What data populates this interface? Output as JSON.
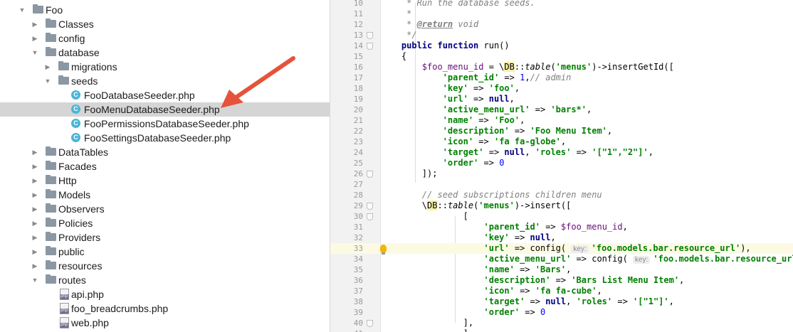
{
  "tree": {
    "items": [
      {
        "label": "Foo",
        "depth": 0,
        "kind": "folder",
        "expanded": true
      },
      {
        "label": "Classes",
        "depth": 1,
        "kind": "folder",
        "expanded": false
      },
      {
        "label": "config",
        "depth": 1,
        "kind": "folder",
        "expanded": false
      },
      {
        "label": "database",
        "depth": 1,
        "kind": "folder",
        "expanded": true
      },
      {
        "label": "migrations",
        "depth": 2,
        "kind": "folder",
        "expanded": false
      },
      {
        "label": "seeds",
        "depth": 2,
        "kind": "folder",
        "expanded": true
      },
      {
        "label": "FooDatabaseSeeder.php",
        "depth": 3,
        "kind": "class"
      },
      {
        "label": "FooMenuDatabaseSeeder.php",
        "depth": 3,
        "kind": "class",
        "selected": true
      },
      {
        "label": "FooPermissionsDatabaseSeeder.php",
        "depth": 3,
        "kind": "class"
      },
      {
        "label": "FooSettingsDatabaseSeeder.php",
        "depth": 3,
        "kind": "class"
      },
      {
        "label": "DataTables",
        "depth": 1,
        "kind": "folder",
        "expanded": false
      },
      {
        "label": "Facades",
        "depth": 1,
        "kind": "folder",
        "expanded": false
      },
      {
        "label": "Http",
        "depth": 1,
        "kind": "folder",
        "expanded": false
      },
      {
        "label": "Models",
        "depth": 1,
        "kind": "folder",
        "expanded": false
      },
      {
        "label": "Observers",
        "depth": 1,
        "kind": "folder",
        "expanded": false
      },
      {
        "label": "Policies",
        "depth": 1,
        "kind": "folder",
        "expanded": false
      },
      {
        "label": "Providers",
        "depth": 1,
        "kind": "folder",
        "expanded": false
      },
      {
        "label": "public",
        "depth": 1,
        "kind": "folder",
        "expanded": false
      },
      {
        "label": "resources",
        "depth": 1,
        "kind": "folder",
        "expanded": false
      },
      {
        "label": "routes",
        "depth": 1,
        "kind": "folder",
        "expanded": true
      },
      {
        "label": "api.php",
        "depth": 2,
        "kind": "php"
      },
      {
        "label": "foo_breadcrumbs.php",
        "depth": 2,
        "kind": "php"
      },
      {
        "label": "web.php",
        "depth": 2,
        "kind": "php"
      }
    ]
  },
  "editor": {
    "current_line": 33,
    "lines": [
      {
        "n": "10",
        "fold": false,
        "tokens": [
          [
            "cmt",
            "     * Run the database seeds."
          ]
        ]
      },
      {
        "n": "11",
        "fold": false,
        "tokens": [
          [
            "cmt",
            "     *"
          ]
        ]
      },
      {
        "n": "12",
        "fold": false,
        "tokens": [
          [
            "cmt",
            "     * "
          ],
          [
            "doctag",
            "@return"
          ],
          [
            "cmt",
            " void"
          ]
        ]
      },
      {
        "n": "13",
        "fold": true,
        "tokens": [
          [
            "cmt",
            "     */"
          ]
        ]
      },
      {
        "n": "14",
        "fold": true,
        "tokens": [
          [
            "",
            "    "
          ],
          [
            "kw",
            "public function "
          ],
          [
            "",
            "run()"
          ]
        ]
      },
      {
        "n": "15",
        "fold": false,
        "tokens": [
          [
            "",
            "    {"
          ]
        ]
      },
      {
        "n": "16",
        "fold": false,
        "tokens": [
          [
            "",
            "        "
          ],
          [
            "var",
            "$foo_menu_id"
          ],
          [
            "",
            " = \\"
          ],
          [
            "cls",
            "DB"
          ],
          [
            "",
            "::"
          ],
          [
            "mth",
            "table"
          ],
          [
            "",
            "("
          ],
          [
            "str",
            "'menus'"
          ],
          [
            "",
            ")->insertGetId(["
          ]
        ]
      },
      {
        "n": "17",
        "fold": false,
        "tokens": [
          [
            "",
            "            "
          ],
          [
            "str",
            "'parent_id'"
          ],
          [
            "",
            " => "
          ],
          [
            "num",
            "1"
          ],
          [
            "",
            ","
          ],
          [
            "cmt",
            "// admin"
          ]
        ]
      },
      {
        "n": "18",
        "fold": false,
        "tokens": [
          [
            "",
            "            "
          ],
          [
            "str",
            "'key'"
          ],
          [
            "",
            " => "
          ],
          [
            "str",
            "'foo'"
          ],
          [
            "",
            ","
          ]
        ]
      },
      {
        "n": "19",
        "fold": false,
        "tokens": [
          [
            "",
            "            "
          ],
          [
            "str",
            "'url'"
          ],
          [
            "",
            " => "
          ],
          [
            "kw",
            "null"
          ],
          [
            "",
            ","
          ]
        ]
      },
      {
        "n": "20",
        "fold": false,
        "tokens": [
          [
            "",
            "            "
          ],
          [
            "str",
            "'active_menu_url'"
          ],
          [
            "",
            " => "
          ],
          [
            "str",
            "'bars*'"
          ],
          [
            "",
            ","
          ]
        ]
      },
      {
        "n": "21",
        "fold": false,
        "tokens": [
          [
            "",
            "            "
          ],
          [
            "str",
            "'name'"
          ],
          [
            "",
            " => "
          ],
          [
            "str",
            "'Foo'"
          ],
          [
            "",
            ","
          ]
        ]
      },
      {
        "n": "22",
        "fold": false,
        "tokens": [
          [
            "",
            "            "
          ],
          [
            "str",
            "'description'"
          ],
          [
            "",
            " => "
          ],
          [
            "str",
            "'Foo Menu Item'"
          ],
          [
            "",
            ","
          ]
        ]
      },
      {
        "n": "23",
        "fold": false,
        "tokens": [
          [
            "",
            "            "
          ],
          [
            "str",
            "'icon'"
          ],
          [
            "",
            " => "
          ],
          [
            "str",
            "'fa fa-globe'"
          ],
          [
            "",
            ","
          ]
        ]
      },
      {
        "n": "24",
        "fold": false,
        "tokens": [
          [
            "",
            "            "
          ],
          [
            "str",
            "'target'"
          ],
          [
            "",
            " => "
          ],
          [
            "kw",
            "null"
          ],
          [
            "",
            ", "
          ],
          [
            "str",
            "'roles'"
          ],
          [
            "",
            " => "
          ],
          [
            "str",
            "'[\"1\",\"2\"]'"
          ],
          [
            "",
            ","
          ]
        ]
      },
      {
        "n": "25",
        "fold": false,
        "tokens": [
          [
            "",
            "            "
          ],
          [
            "str",
            "'order'"
          ],
          [
            "",
            " => "
          ],
          [
            "num",
            "0"
          ]
        ]
      },
      {
        "n": "26",
        "fold": true,
        "tokens": [
          [
            "",
            "        ]);"
          ]
        ]
      },
      {
        "n": "27",
        "fold": false,
        "tokens": [
          [
            "",
            ""
          ]
        ]
      },
      {
        "n": "28",
        "fold": false,
        "tokens": [
          [
            "",
            "        "
          ],
          [
            "cmt",
            "// seed subscriptions children menu"
          ]
        ]
      },
      {
        "n": "29",
        "fold": true,
        "tokens": [
          [
            "",
            "        \\"
          ],
          [
            "cls",
            "DB"
          ],
          [
            "",
            "::"
          ],
          [
            "mth",
            "table"
          ],
          [
            "",
            "("
          ],
          [
            "str",
            "'menus'"
          ],
          [
            "",
            ")->insert(["
          ]
        ]
      },
      {
        "n": "30",
        "fold": true,
        "tokens": [
          [
            "",
            "                ["
          ]
        ]
      },
      {
        "n": "31",
        "fold": false,
        "tokens": [
          [
            "",
            "                    "
          ],
          [
            "str",
            "'parent_id'"
          ],
          [
            "",
            " => "
          ],
          [
            "var",
            "$foo_menu_id"
          ],
          [
            "",
            ","
          ]
        ]
      },
      {
        "n": "32",
        "fold": false,
        "tokens": [
          [
            "",
            "                    "
          ],
          [
            "str",
            "'key'"
          ],
          [
            "",
            " => "
          ],
          [
            "kw",
            "null"
          ],
          [
            "",
            ","
          ]
        ]
      },
      {
        "n": "33",
        "fold": false,
        "tokens": [
          [
            "",
            "                    "
          ],
          [
            "str",
            "'url'"
          ],
          [
            "",
            " => config( "
          ],
          [
            "hint",
            "key:"
          ],
          [
            "str",
            "'foo.models.bar.resource_url'"
          ],
          [
            "",
            "),"
          ]
        ]
      },
      {
        "n": "34",
        "fold": false,
        "tokens": [
          [
            "",
            "                    "
          ],
          [
            "str",
            "'active_menu_url'"
          ],
          [
            "",
            " => config( "
          ],
          [
            "hint",
            "key:"
          ],
          [
            "str",
            "'foo.models.bar.resource_url'"
          ],
          [
            "",
            ")"
          ]
        ]
      },
      {
        "n": "35",
        "fold": false,
        "tokens": [
          [
            "",
            "                    "
          ],
          [
            "str",
            "'name'"
          ],
          [
            "",
            " => "
          ],
          [
            "str",
            "'Bars'"
          ],
          [
            "",
            ","
          ]
        ]
      },
      {
        "n": "36",
        "fold": false,
        "tokens": [
          [
            "",
            "                    "
          ],
          [
            "str",
            "'description'"
          ],
          [
            "",
            " => "
          ],
          [
            "str",
            "'Bars List Menu Item'"
          ],
          [
            "",
            ","
          ]
        ]
      },
      {
        "n": "37",
        "fold": false,
        "tokens": [
          [
            "",
            "                    "
          ],
          [
            "str",
            "'icon'"
          ],
          [
            "",
            " => "
          ],
          [
            "str",
            "'fa fa-cube'"
          ],
          [
            "",
            ","
          ]
        ]
      },
      {
        "n": "38",
        "fold": false,
        "tokens": [
          [
            "",
            "                    "
          ],
          [
            "str",
            "'target'"
          ],
          [
            "",
            " => "
          ],
          [
            "kw",
            "null"
          ],
          [
            "",
            ", "
          ],
          [
            "str",
            "'roles'"
          ],
          [
            "",
            " => "
          ],
          [
            "str",
            "'[\"1\"]'"
          ],
          [
            "",
            ","
          ]
        ]
      },
      {
        "n": "39",
        "fold": false,
        "tokens": [
          [
            "",
            "                    "
          ],
          [
            "str",
            "'order'"
          ],
          [
            "",
            " => "
          ],
          [
            "num",
            "0"
          ]
        ]
      },
      {
        "n": "40",
        "fold": true,
        "tokens": [
          [
            "",
            "                ],"
          ]
        ]
      },
      {
        "n": "41",
        "fold": false,
        "tokens": [
          [
            "",
            "                ],"
          ]
        ]
      }
    ]
  },
  "colors": {
    "selection": "#d5d5d5",
    "current_line": "#fcfae3",
    "keyword": "#000080",
    "string": "#008000",
    "comment": "#808080",
    "variable": "#660e7a",
    "callout_arrow": "#e5533b"
  }
}
